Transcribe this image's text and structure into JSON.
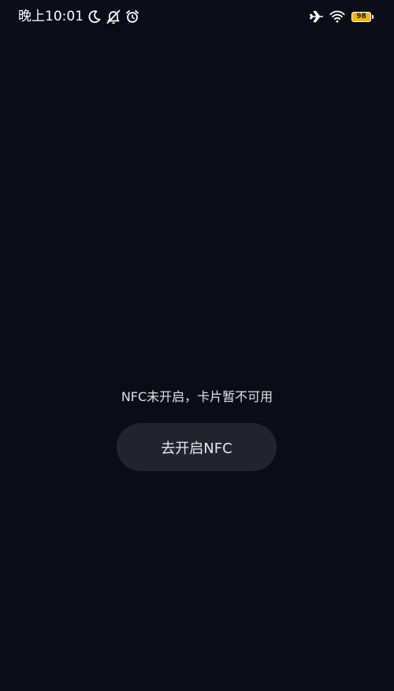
{
  "status_bar": {
    "time": "晚上10:01",
    "icons_left": [
      "moon-icon",
      "mute-icon",
      "alarm-icon"
    ],
    "icons_right": [
      "airplane-icon",
      "wifi-icon"
    ],
    "battery_level": "98",
    "battery_color": "#f2b701"
  },
  "main": {
    "message": "NFC未开启，卡片暂不可用",
    "action_button_label": "去开启NFC"
  },
  "colors": {
    "background": "#0a0d17",
    "button_background": "#22252e",
    "text": "#dfe2ea"
  }
}
